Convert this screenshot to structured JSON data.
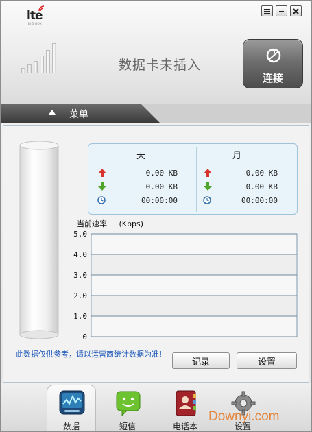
{
  "header": {
    "logo_text": "lte",
    "logo_sub": "BIG BOX",
    "status": "数据卡未插入",
    "connect_label": "连接",
    "window_buttons": [
      "menu",
      "minimize",
      "close"
    ]
  },
  "menu": {
    "label": "菜单"
  },
  "stats": {
    "day_label": "天",
    "month_label": "月",
    "day": {
      "upload": "0.00 KB",
      "download": "0.00 KB",
      "duration": "00:00:00"
    },
    "month": {
      "upload": "0.00 KB",
      "download": "0.00 KB",
      "duration": "00:00:00"
    }
  },
  "speed": {
    "label": "当前速率",
    "unit": "(Kbps)"
  },
  "chart_data": {
    "type": "line",
    "title": "",
    "ylabel": "(Kbps)",
    "ylim": [
      0,
      5
    ],
    "y_ticks": [
      "5.0",
      "4.0",
      "3.0",
      "2.0",
      "1.0",
      "0"
    ],
    "series": []
  },
  "note": "此数据仅供参考，请以运营商统计数据为准!",
  "buttons": {
    "record": "记录",
    "settings": "设置"
  },
  "nav": [
    {
      "label": "数据",
      "icon": "data-chart-icon",
      "active": true
    },
    {
      "label": "短信",
      "icon": "sms-icon",
      "active": false
    },
    {
      "label": "电话本",
      "icon": "phonebook-icon",
      "active": false
    },
    {
      "label": "设置",
      "icon": "gear-icon",
      "active": false
    }
  ],
  "watermark": "Downyi.com",
  "colors": {
    "note_text": "#1a56b8",
    "upload_arrow": "#d9342b",
    "download_arrow": "#4ea52a",
    "stats_border": "#9ec3da"
  }
}
